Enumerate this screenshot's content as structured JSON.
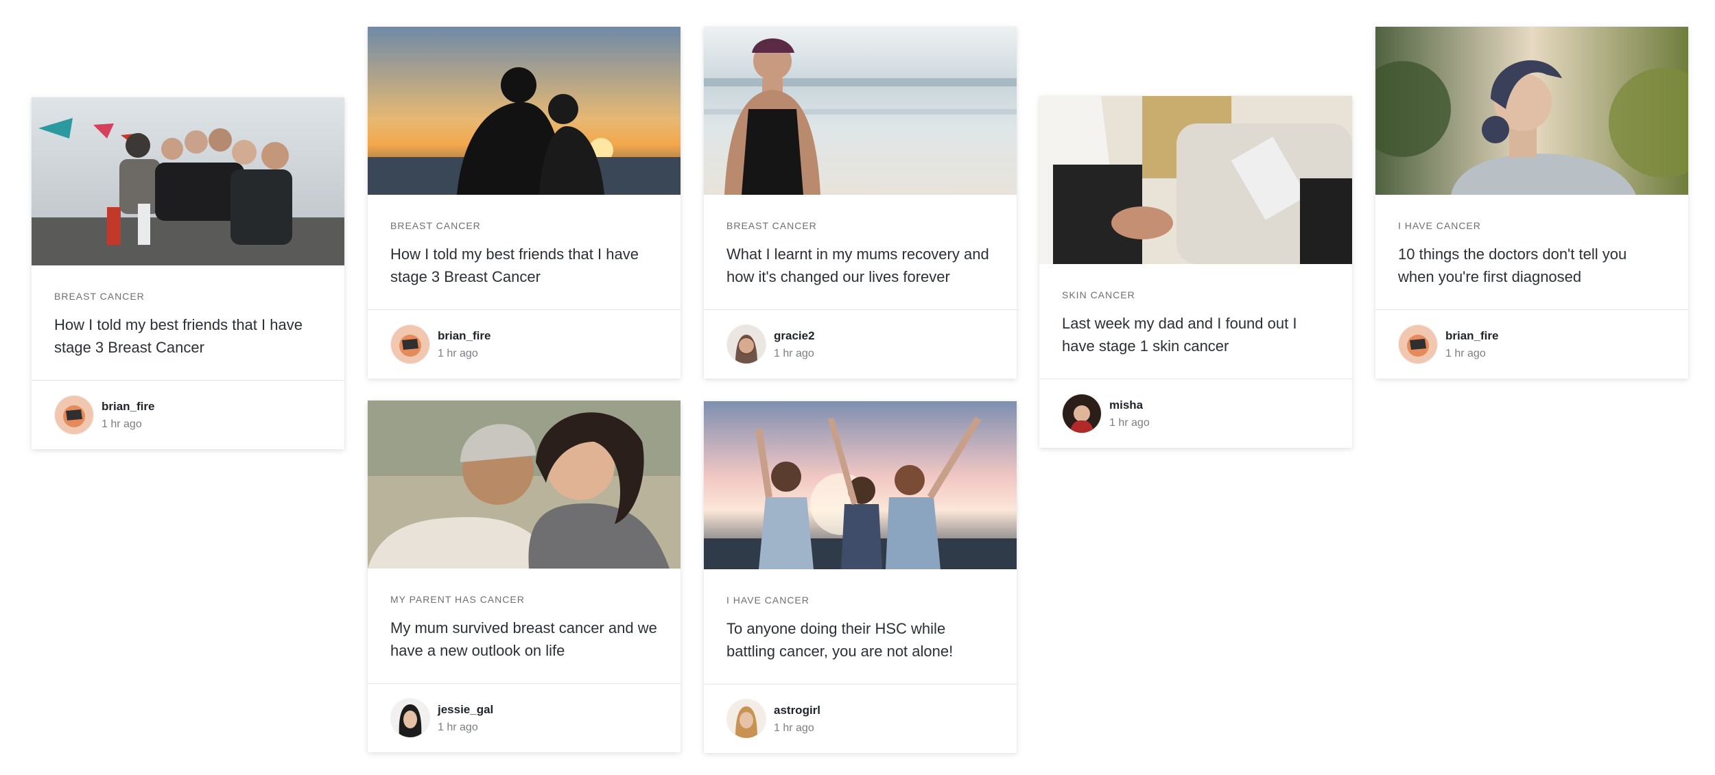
{
  "cards": [
    {
      "category": "BREAST CANCER",
      "title": "How I told my best friends that I have stage 3 Breast Cancer",
      "author": "brian_fire",
      "time": "1 hr ago",
      "image": "group-of-friends-photo",
      "avatar": "brian-avatar"
    },
    {
      "category": "BREAST CANCER",
      "title": "How I told my best friends that I have stage 3 Breast Cancer",
      "author": "brian_fire",
      "time": "1 hr ago",
      "image": "couple-sunset-photo",
      "avatar": "brian-avatar"
    },
    {
      "category": "BREAST CANCER",
      "title": "What I learnt in my mums recovery and how it's changed our lives forever",
      "author": "gracie2",
      "time": "1 hr ago",
      "image": "woman-beach-photo",
      "avatar": "gracie-avatar"
    },
    {
      "category": "SKIN CANCER",
      "title": "Last week my dad and I found out I have stage 1 skin cancer",
      "author": "misha",
      "time": "1 hr ago",
      "image": "doctor-consultation-photo",
      "avatar": "misha-avatar"
    },
    {
      "category": "I HAVE CANCER",
      "title": "10 things the doctors don't tell you when you're first diagnosed",
      "author": "brian_fire",
      "time": "1 hr ago",
      "image": "woman-headscarf-photo",
      "avatar": "brian-avatar"
    },
    {
      "category": "MY PARENT HAS CANCER",
      "title": "My mum survived breast cancer and we have a new outlook on life",
      "author": "jessie_gal",
      "time": "1 hr ago",
      "image": "mother-daughter-photo",
      "avatar": "jessie-avatar"
    },
    {
      "category": "I HAVE CANCER",
      "title": "To anyone doing their HSC while battling cancer, you are not alone!",
      "author": "astrogirl",
      "time": "1 hr ago",
      "image": "friends-celebrating-photo",
      "avatar": "astro-avatar"
    }
  ]
}
